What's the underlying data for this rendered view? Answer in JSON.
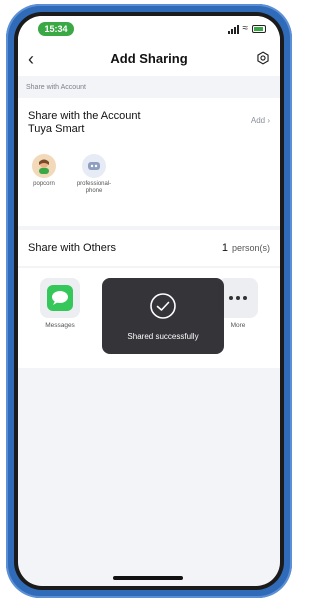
{
  "status_bar": {
    "time": "15:34",
    "accent_color": "#3aa845"
  },
  "header": {
    "title": "Add Sharing"
  },
  "account_section": {
    "label": "Share with Account",
    "title_line1": "Share with the Account",
    "title_line2": "Tuya Smart",
    "add_label": "Add",
    "members": [
      {
        "name": "popcorn",
        "icon": "person-avatar-icon"
      },
      {
        "name": "professional-phone",
        "icon": "device-avatar-icon"
      }
    ]
  },
  "others_section": {
    "title": "Share with Others",
    "count": "1",
    "count_unit": "person(s)"
  },
  "share_targets": [
    {
      "label": "Messages",
      "icon": "messages-icon"
    },
    {
      "label": "More",
      "icon": "more-icon"
    }
  ],
  "toast": {
    "message": "Shared successfully",
    "icon": "check-circle-icon"
  },
  "colors": {
    "frame": "#2f6bb8",
    "messages_green": "#35c759",
    "toast_bg": "#232328"
  }
}
